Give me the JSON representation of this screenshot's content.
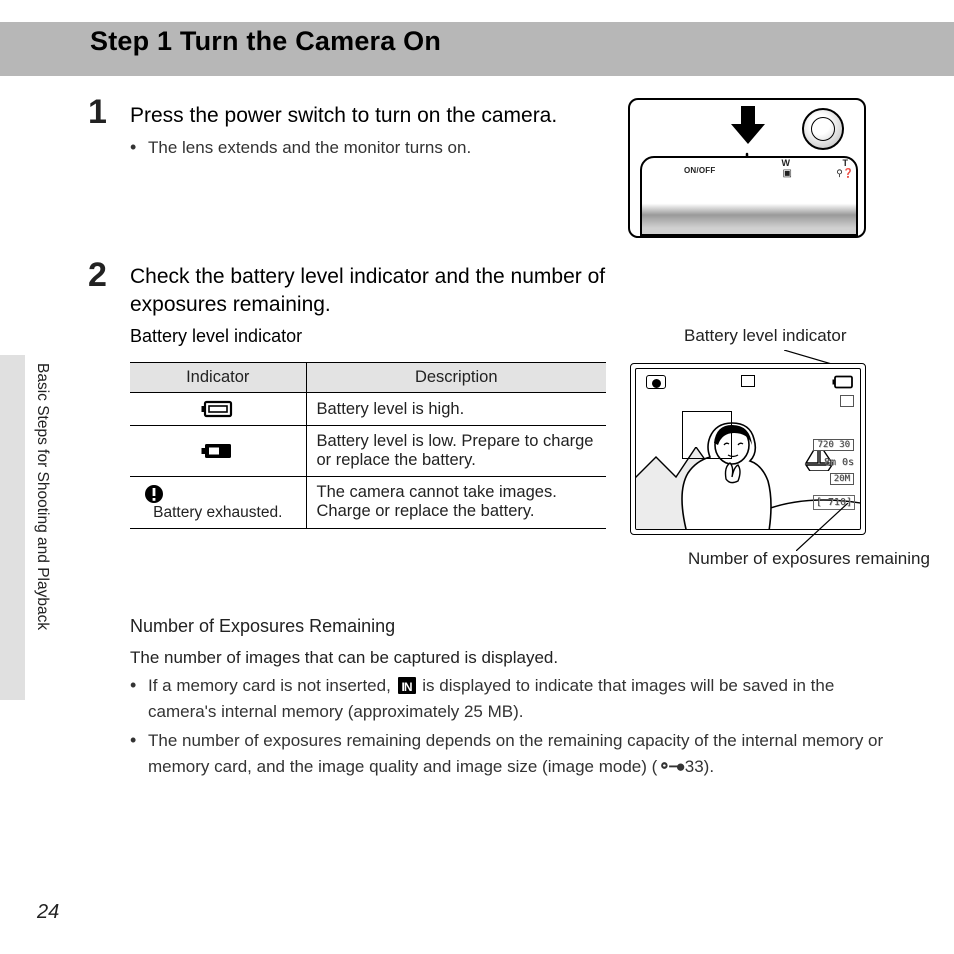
{
  "header": {
    "title": "Step 1 Turn the Camera On"
  },
  "sidebar": {
    "label": "Basic Steps for Shooting and Playback"
  },
  "steps": {
    "s1": {
      "num": "1",
      "text": "Press the power switch to turn on the camera.",
      "bullets": [
        "The lens extends and the monitor turns on."
      ]
    },
    "s2": {
      "num": "2",
      "text": "Check the battery level indicator and the number of exposures remaining."
    }
  },
  "camera": {
    "onoff": "ON/OFF",
    "W": "W",
    "T": "T",
    "tq": "⚲❓",
    "wicon": "▣"
  },
  "battery_section": {
    "heading": "Battery level indicator",
    "table": {
      "head": {
        "c1": "Indicator",
        "c2": "Description"
      },
      "rows": [
        {
          "desc": "Battery level is high."
        },
        {
          "desc": "Battery level is low. Prepare to charge or replace the battery."
        },
        {
          "label": "Battery exhausted.",
          "desc": "The camera cannot take images. Charge or replace the battery."
        }
      ]
    }
  },
  "monitor": {
    "label_top": "Battery level indicator",
    "label_bottom": "Number of exposures remaining",
    "osd": {
      "res": "720 30",
      "time": "8m 0s",
      "mode": "20M",
      "count": "[  710]"
    }
  },
  "exposures": {
    "heading": "Number of Exposures Remaining",
    "desc": "The number of images that can be captured is displayed.",
    "b1a": "If a memory card is not inserted, ",
    "b1b": " is displayed to indicate that images will be saved in the camera's internal memory (approximately 25 MB).",
    "b2a": "The number of exposures remaining depends on the remaining capacity of the internal memory or memory card, and the image quality and image size (image mode) (",
    "b2b": "33).",
    "in_icon": "IN"
  },
  "page_number": "24"
}
